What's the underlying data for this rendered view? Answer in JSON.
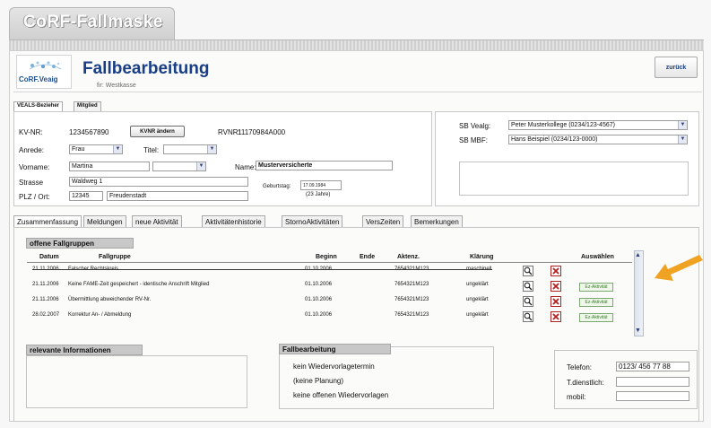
{
  "window": {
    "title": "CoRF-Fallmaske"
  },
  "header": {
    "logo_text": "CoRF.Veaig",
    "title": "Fallbearbeitung",
    "subtitle": "fir: Westkasse",
    "back_label": "zurück"
  },
  "sub_tabs": [
    {
      "label": "VEALS-Bezieher"
    },
    {
      "label": "Mitglied"
    }
  ],
  "person": {
    "kvnr_label": "KV-NR:",
    "kvnr_value": "1234567890",
    "kvnr_button": "KVNR ändern",
    "rvnr_label": "RVNR:",
    "rvnr_value": "11170984A000",
    "anrede_label": "Anrede:",
    "anrede_value": "Frau",
    "titel_label": "Titel:",
    "titel_value": "",
    "vorname_label": "Vorname:",
    "vorname_value": "Martina",
    "name_label": "Name:",
    "name_value": "Musterversicherte",
    "strasse_label": "Strasse",
    "strasse_value": "Waldweg 1",
    "geburtstag_label": "Geburtstag:",
    "geburtstag_value": "17.09.1984",
    "alter": "(23 Jahre)",
    "plz_label": "PLZ / Ort:",
    "plz_value": "12345",
    "ort_value": "Freudenstadt"
  },
  "sb": {
    "vealg_label": "SB Vealg:",
    "vealg_value": "Peter Musterkollege (0234/123-4567)",
    "mbf_label": "SB MBF:",
    "mbf_value": "Hans Beispiel (0234/123-0000)"
  },
  "main_tabs": [
    {
      "label": "Zusammenfassung"
    },
    {
      "label": "Meldungen"
    },
    {
      "label": "neue Aktivität"
    },
    {
      "label": "Aktivitätenhistorie"
    },
    {
      "label": "StornoAktivitäten"
    },
    {
      "label": "VersZeiten"
    },
    {
      "label": "Bemerkungen"
    }
  ],
  "fallgruppen": {
    "title": "offene Fallgruppen",
    "columns": [
      "Datum",
      "Fallgruppe",
      "Beginn",
      "Ende",
      "Aktenz.",
      "Klärung",
      "Auswählen"
    ],
    "rows": [
      {
        "datum": "21.11.2006",
        "fallgruppe": "Falscher Rechtskreis",
        "beginn": "01.10.2006",
        "ende": "",
        "aktenz": "7654321M123",
        "klaerung": "maschinell",
        "action": ""
      },
      {
        "datum": "21.11.2006",
        "fallgruppe": "Keine FAME-Zeit gespeichert - identische Anschrift Mitglied",
        "beginn": "01.10.2006",
        "ende": "",
        "aktenz": "7654321M123",
        "klaerung": "ungeklärt",
        "action": "Ez-Aktivität"
      },
      {
        "datum": "21.11.2006",
        "fallgruppe": "Übermittlung abweichender RV-Nr.",
        "beginn": "01.10.2006",
        "ende": "",
        "aktenz": "7654321M123",
        "klaerung": "ungeklärt",
        "action": "Ez-Aktivität"
      },
      {
        "datum": "28.02.2007",
        "fallgruppe": "Korrektur An- / Abmeldung",
        "beginn": "01.10.2006",
        "ende": "",
        "aktenz": "7654321M123",
        "klaerung": "ungeklärt",
        "action": "Ez-Aktivität"
      }
    ]
  },
  "relevante": {
    "title": "relevante Informationen"
  },
  "fallbearbeitung": {
    "title": "Fallbearbeitung",
    "lines": [
      "kein Wiedervorlagetermin",
      "(keine Planung)",
      "keine offenen Wiedervorlagen"
    ]
  },
  "kontakt": {
    "telefon_label": "Telefon:",
    "telefon_value": "0123/ 456 77 88",
    "dienstlich_label": "T.dienstlich:",
    "dienstlich_value": "",
    "mobil_label": "mobil:",
    "mobil_value": ""
  },
  "colors": {
    "title_blue": "#183e86",
    "arrow": "#f0a323",
    "delete_red": "#b32020"
  },
  "icons": [
    "magnifier-icon",
    "delete-icon",
    "arrow-icon",
    "chevron-down-icon"
  ]
}
